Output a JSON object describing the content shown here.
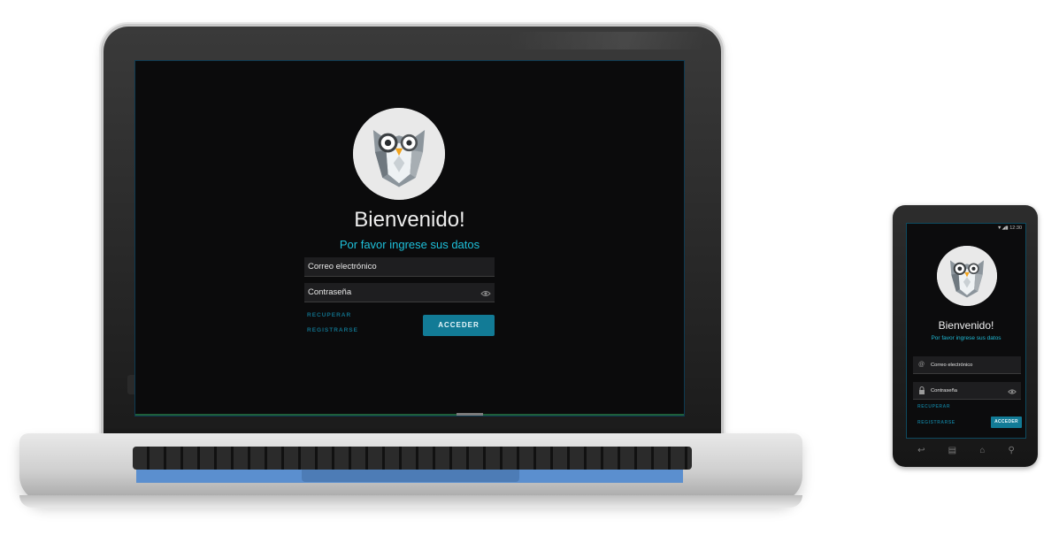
{
  "laptop": {
    "welcome_title": "Bienvenido!",
    "subtitle": "Por favor ingrese sus datos",
    "email_placeholder": "Correo electrónico",
    "password_placeholder": "Contraseña",
    "recover_link": "RECUPERAR",
    "register_link": "REGISTRARSE",
    "login_button": "ACCEDER"
  },
  "phone": {
    "status_time": "12:30",
    "welcome_title": "Bienvenido!",
    "subtitle": "Por favor ingrese sus datos",
    "email_placeholder": "Correo electrónico",
    "password_placeholder": "Contraseña",
    "recover_link": "RECUPERAR",
    "register_link": "REGISTRARSE",
    "login_button": "ACCEDER"
  },
  "icons": {
    "owl_logo": "owl-icon",
    "eye": "eye-icon",
    "at_sign": "at-icon",
    "lock": "lock-icon",
    "back": "back-icon",
    "home": "home-icon",
    "recent": "recent-apps-icon",
    "search": "search-icon"
  },
  "colors": {
    "accent": "#1ec0da",
    "button": "#127b96",
    "link": "#11708a",
    "screen_bg": "#0b0b0c",
    "field_bg": "#1e1e20"
  }
}
